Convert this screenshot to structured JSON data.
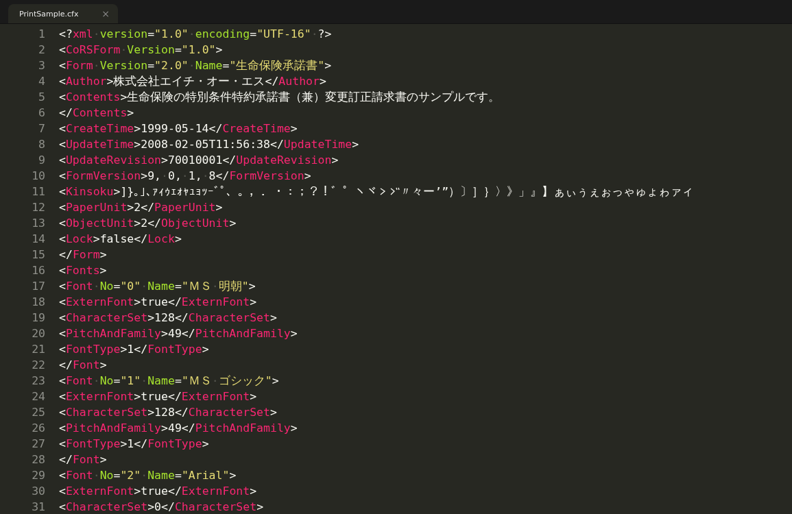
{
  "tabs": [
    {
      "label": "PrintSample.cfx",
      "close": "×",
      "selected": true
    }
  ],
  "editor": {
    "lines": [
      {
        "number": "1",
        "tokens": [
          {
            "kind": "punct",
            "text": "<?"
          },
          {
            "kind": "tag",
            "text": "xml"
          },
          {
            "kind": "ws",
            "text": "·"
          },
          {
            "kind": "attr",
            "text": "version"
          },
          {
            "kind": "punct",
            "text": "="
          },
          {
            "kind": "string",
            "text": "\"1.0\""
          },
          {
            "kind": "ws",
            "text": "·"
          },
          {
            "kind": "attr",
            "text": "encoding"
          },
          {
            "kind": "punct",
            "text": "="
          },
          {
            "kind": "string",
            "text": "\"UTF-16\""
          },
          {
            "kind": "ws",
            "text": "·"
          },
          {
            "kind": "punct",
            "text": "?>"
          }
        ]
      },
      {
        "number": "2",
        "tokens": [
          {
            "kind": "punct",
            "text": "<"
          },
          {
            "kind": "tag",
            "text": "CoRSForm"
          },
          {
            "kind": "ws",
            "text": "·"
          },
          {
            "kind": "attr",
            "text": "Version"
          },
          {
            "kind": "punct",
            "text": "="
          },
          {
            "kind": "string",
            "text": "\"1.0\""
          },
          {
            "kind": "punct",
            "text": ">"
          }
        ]
      },
      {
        "number": "3",
        "tokens": [
          {
            "kind": "punct",
            "text": "<"
          },
          {
            "kind": "tag",
            "text": "Form"
          },
          {
            "kind": "ws",
            "text": "·"
          },
          {
            "kind": "attr",
            "text": "Version"
          },
          {
            "kind": "punct",
            "text": "="
          },
          {
            "kind": "string",
            "text": "\"2.0\""
          },
          {
            "kind": "ws",
            "text": "·"
          },
          {
            "kind": "attr",
            "text": "Name"
          },
          {
            "kind": "punct",
            "text": "="
          },
          {
            "kind": "string",
            "text": "\"生命保険承諾書\""
          },
          {
            "kind": "punct",
            "text": ">"
          }
        ]
      },
      {
        "number": "4",
        "tokens": [
          {
            "kind": "punct",
            "text": "<"
          },
          {
            "kind": "tag",
            "text": "Author"
          },
          {
            "kind": "punct",
            "text": ">"
          },
          {
            "kind": "text",
            "text": "株式会社エイチ・オー・エス"
          },
          {
            "kind": "punct",
            "text": "</"
          },
          {
            "kind": "tag",
            "text": "Author"
          },
          {
            "kind": "punct",
            "text": ">"
          }
        ]
      },
      {
        "number": "5",
        "tokens": [
          {
            "kind": "punct",
            "text": "<"
          },
          {
            "kind": "tag",
            "text": "Contents"
          },
          {
            "kind": "punct",
            "text": ">"
          },
          {
            "kind": "text",
            "text": "生命保険の特別条件特約承諾書（兼）変更訂正請求書のサンプルです。"
          }
        ]
      },
      {
        "number": "6",
        "tokens": [
          {
            "kind": "punct",
            "text": "</"
          },
          {
            "kind": "tag",
            "text": "Contents"
          },
          {
            "kind": "punct",
            "text": ">"
          }
        ]
      },
      {
        "number": "7",
        "tokens": [
          {
            "kind": "punct",
            "text": "<"
          },
          {
            "kind": "tag",
            "text": "CreateTime"
          },
          {
            "kind": "punct",
            "text": ">"
          },
          {
            "kind": "text",
            "text": "1999-05-14"
          },
          {
            "kind": "punct",
            "text": "</"
          },
          {
            "kind": "tag",
            "text": "CreateTime"
          },
          {
            "kind": "punct",
            "text": ">"
          }
        ]
      },
      {
        "number": "8",
        "tokens": [
          {
            "kind": "punct",
            "text": "<"
          },
          {
            "kind": "tag",
            "text": "UpdateTime"
          },
          {
            "kind": "punct",
            "text": ">"
          },
          {
            "kind": "text",
            "text": "2008-02-05T11:56:38"
          },
          {
            "kind": "punct",
            "text": "</"
          },
          {
            "kind": "tag",
            "text": "UpdateTime"
          },
          {
            "kind": "punct",
            "text": ">"
          }
        ]
      },
      {
        "number": "9",
        "tokens": [
          {
            "kind": "punct",
            "text": "<"
          },
          {
            "kind": "tag",
            "text": "UpdateRevision"
          },
          {
            "kind": "punct",
            "text": ">"
          },
          {
            "kind": "text",
            "text": "70010001"
          },
          {
            "kind": "punct",
            "text": "</"
          },
          {
            "kind": "tag",
            "text": "UpdateRevision"
          },
          {
            "kind": "punct",
            "text": ">"
          }
        ]
      },
      {
        "number": "10",
        "tokens": [
          {
            "kind": "punct",
            "text": "<"
          },
          {
            "kind": "tag",
            "text": "FormVersion"
          },
          {
            "kind": "punct",
            "text": ">"
          },
          {
            "kind": "text",
            "text": "9,"
          },
          {
            "kind": "ws",
            "text": "·"
          },
          {
            "kind": "text",
            "text": "0,"
          },
          {
            "kind": "ws",
            "text": "·"
          },
          {
            "kind": "text",
            "text": "1,"
          },
          {
            "kind": "ws",
            "text": "·"
          },
          {
            "kind": "text",
            "text": "8"
          },
          {
            "kind": "punct",
            "text": "</"
          },
          {
            "kind": "tag",
            "text": "FormVersion"
          },
          {
            "kind": "punct",
            "text": ">"
          }
        ]
      },
      {
        "number": "11",
        "tokens": [
          {
            "kind": "punct",
            "text": "<"
          },
          {
            "kind": "tag",
            "text": "Kinsoku"
          },
          {
            "kind": "punct",
            "text": ">"
          },
          {
            "kind": "text",
            "text": "]}｡｣､ｧｨｩｪｫｬｭｮｯｰﾞﾟ、。，．・：；？！゛゜ヽヾ"
          },
          {
            "kind": "iteration-mark",
            "voiced": false
          },
          {
            "kind": "iteration-mark",
            "voiced": true
          },
          {
            "kind": "text",
            "text": "〃々ー’”）〕］｝〉》」』】ぁぃぅぇぉっゃゅょゎァィ"
          }
        ]
      },
      {
        "number": "12",
        "tokens": [
          {
            "kind": "punct",
            "text": "<"
          },
          {
            "kind": "tag",
            "text": "PaperUnit"
          },
          {
            "kind": "punct",
            "text": ">"
          },
          {
            "kind": "text",
            "text": "2"
          },
          {
            "kind": "punct",
            "text": "</"
          },
          {
            "kind": "tag",
            "text": "PaperUnit"
          },
          {
            "kind": "punct",
            "text": ">"
          }
        ]
      },
      {
        "number": "13",
        "tokens": [
          {
            "kind": "punct",
            "text": "<"
          },
          {
            "kind": "tag",
            "text": "ObjectUnit"
          },
          {
            "kind": "punct",
            "text": ">"
          },
          {
            "kind": "text",
            "text": "2"
          },
          {
            "kind": "punct",
            "text": "</"
          },
          {
            "kind": "tag",
            "text": "ObjectUnit"
          },
          {
            "kind": "punct",
            "text": ">"
          }
        ]
      },
      {
        "number": "14",
        "tokens": [
          {
            "kind": "punct",
            "text": "<"
          },
          {
            "kind": "tag",
            "text": "Lock"
          },
          {
            "kind": "punct",
            "text": ">"
          },
          {
            "kind": "text",
            "text": "false"
          },
          {
            "kind": "punct",
            "text": "</"
          },
          {
            "kind": "tag",
            "text": "Lock"
          },
          {
            "kind": "punct",
            "text": ">"
          }
        ]
      },
      {
        "number": "15",
        "tokens": [
          {
            "kind": "punct",
            "text": "</"
          },
          {
            "kind": "tag",
            "text": "Form"
          },
          {
            "kind": "punct",
            "text": ">"
          }
        ]
      },
      {
        "number": "16",
        "tokens": [
          {
            "kind": "punct",
            "text": "<"
          },
          {
            "kind": "tag",
            "text": "Fonts"
          },
          {
            "kind": "punct",
            "text": ">"
          }
        ]
      },
      {
        "number": "17",
        "tokens": [
          {
            "kind": "punct",
            "text": "<"
          },
          {
            "kind": "tag",
            "text": "Font"
          },
          {
            "kind": "ws",
            "text": "·"
          },
          {
            "kind": "attr",
            "text": "No"
          },
          {
            "kind": "punct",
            "text": "="
          },
          {
            "kind": "string",
            "text": "\"0\""
          },
          {
            "kind": "ws",
            "text": "·"
          },
          {
            "kind": "attr",
            "text": "Name"
          },
          {
            "kind": "punct",
            "text": "="
          },
          {
            "kind": "string",
            "text": "\"ＭＳ"
          },
          {
            "kind": "ws",
            "text": "·"
          },
          {
            "kind": "string",
            "text": "明朝\""
          },
          {
            "kind": "punct",
            "text": ">"
          }
        ]
      },
      {
        "number": "18",
        "tokens": [
          {
            "kind": "punct",
            "text": "<"
          },
          {
            "kind": "tag",
            "text": "ExternFont"
          },
          {
            "kind": "punct",
            "text": ">"
          },
          {
            "kind": "text",
            "text": "true"
          },
          {
            "kind": "punct",
            "text": "</"
          },
          {
            "kind": "tag",
            "text": "ExternFont"
          },
          {
            "kind": "punct",
            "text": ">"
          }
        ]
      },
      {
        "number": "19",
        "tokens": [
          {
            "kind": "punct",
            "text": "<"
          },
          {
            "kind": "tag",
            "text": "CharacterSet"
          },
          {
            "kind": "punct",
            "text": ">"
          },
          {
            "kind": "text",
            "text": "128"
          },
          {
            "kind": "punct",
            "text": "</"
          },
          {
            "kind": "tag",
            "text": "CharacterSet"
          },
          {
            "kind": "punct",
            "text": ">"
          }
        ]
      },
      {
        "number": "20",
        "tokens": [
          {
            "kind": "punct",
            "text": "<"
          },
          {
            "kind": "tag",
            "text": "PitchAndFamily"
          },
          {
            "kind": "punct",
            "text": ">"
          },
          {
            "kind": "text",
            "text": "49"
          },
          {
            "kind": "punct",
            "text": "</"
          },
          {
            "kind": "tag",
            "text": "PitchAndFamily"
          },
          {
            "kind": "punct",
            "text": ">"
          }
        ]
      },
      {
        "number": "21",
        "tokens": [
          {
            "kind": "punct",
            "text": "<"
          },
          {
            "kind": "tag",
            "text": "FontType"
          },
          {
            "kind": "punct",
            "text": ">"
          },
          {
            "kind": "text",
            "text": "1"
          },
          {
            "kind": "punct",
            "text": "</"
          },
          {
            "kind": "tag",
            "text": "FontType"
          },
          {
            "kind": "punct",
            "text": ">"
          }
        ]
      },
      {
        "number": "22",
        "tokens": [
          {
            "kind": "punct",
            "text": "</"
          },
          {
            "kind": "tag",
            "text": "Font"
          },
          {
            "kind": "punct",
            "text": ">"
          }
        ]
      },
      {
        "number": "23",
        "tokens": [
          {
            "kind": "punct",
            "text": "<"
          },
          {
            "kind": "tag",
            "text": "Font"
          },
          {
            "kind": "ws",
            "text": "·"
          },
          {
            "kind": "attr",
            "text": "No"
          },
          {
            "kind": "punct",
            "text": "="
          },
          {
            "kind": "string",
            "text": "\"1\""
          },
          {
            "kind": "ws",
            "text": "·"
          },
          {
            "kind": "attr",
            "text": "Name"
          },
          {
            "kind": "punct",
            "text": "="
          },
          {
            "kind": "string",
            "text": "\"ＭＳ"
          },
          {
            "kind": "ws",
            "text": "·"
          },
          {
            "kind": "string",
            "text": "ゴシック\""
          },
          {
            "kind": "punct",
            "text": ">"
          }
        ]
      },
      {
        "number": "24",
        "tokens": [
          {
            "kind": "punct",
            "text": "<"
          },
          {
            "kind": "tag",
            "text": "ExternFont"
          },
          {
            "kind": "punct",
            "text": ">"
          },
          {
            "kind": "text",
            "text": "true"
          },
          {
            "kind": "punct",
            "text": "</"
          },
          {
            "kind": "tag",
            "text": "ExternFont"
          },
          {
            "kind": "punct",
            "text": ">"
          }
        ]
      },
      {
        "number": "25",
        "tokens": [
          {
            "kind": "punct",
            "text": "<"
          },
          {
            "kind": "tag",
            "text": "CharacterSet"
          },
          {
            "kind": "punct",
            "text": ">"
          },
          {
            "kind": "text",
            "text": "128"
          },
          {
            "kind": "punct",
            "text": "</"
          },
          {
            "kind": "tag",
            "text": "CharacterSet"
          },
          {
            "kind": "punct",
            "text": ">"
          }
        ]
      },
      {
        "number": "26",
        "tokens": [
          {
            "kind": "punct",
            "text": "<"
          },
          {
            "kind": "tag",
            "text": "PitchAndFamily"
          },
          {
            "kind": "punct",
            "text": ">"
          },
          {
            "kind": "text",
            "text": "49"
          },
          {
            "kind": "punct",
            "text": "</"
          },
          {
            "kind": "tag",
            "text": "PitchAndFamily"
          },
          {
            "kind": "punct",
            "text": ">"
          }
        ]
      },
      {
        "number": "27",
        "tokens": [
          {
            "kind": "punct",
            "text": "<"
          },
          {
            "kind": "tag",
            "text": "FontType"
          },
          {
            "kind": "punct",
            "text": ">"
          },
          {
            "kind": "text",
            "text": "1"
          },
          {
            "kind": "punct",
            "text": "</"
          },
          {
            "kind": "tag",
            "text": "FontType"
          },
          {
            "kind": "punct",
            "text": ">"
          }
        ]
      },
      {
        "number": "28",
        "tokens": [
          {
            "kind": "punct",
            "text": "</"
          },
          {
            "kind": "tag",
            "text": "Font"
          },
          {
            "kind": "punct",
            "text": ">"
          }
        ]
      },
      {
        "number": "29",
        "tokens": [
          {
            "kind": "punct",
            "text": "<"
          },
          {
            "kind": "tag",
            "text": "Font"
          },
          {
            "kind": "ws",
            "text": "·"
          },
          {
            "kind": "attr",
            "text": "No"
          },
          {
            "kind": "punct",
            "text": "="
          },
          {
            "kind": "string",
            "text": "\"2\""
          },
          {
            "kind": "ws",
            "text": "·"
          },
          {
            "kind": "attr",
            "text": "Name"
          },
          {
            "kind": "punct",
            "text": "="
          },
          {
            "kind": "string",
            "text": "\"Arial\""
          },
          {
            "kind": "punct",
            "text": ">"
          }
        ]
      },
      {
        "number": "30",
        "tokens": [
          {
            "kind": "punct",
            "text": "<"
          },
          {
            "kind": "tag",
            "text": "ExternFont"
          },
          {
            "kind": "punct",
            "text": ">"
          },
          {
            "kind": "text",
            "text": "true"
          },
          {
            "kind": "punct",
            "text": "</"
          },
          {
            "kind": "tag",
            "text": "ExternFont"
          },
          {
            "kind": "punct",
            "text": ">"
          }
        ]
      },
      {
        "number": "31",
        "tokens": [
          {
            "kind": "punct",
            "text": "<"
          },
          {
            "kind": "tag",
            "text": "CharacterSet"
          },
          {
            "kind": "punct",
            "text": ">"
          },
          {
            "kind": "text",
            "text": "0"
          },
          {
            "kind": "punct",
            "text": "</"
          },
          {
            "kind": "tag",
            "text": "CharacterSet"
          },
          {
            "kind": "punct",
            "text": ">"
          }
        ]
      }
    ]
  }
}
